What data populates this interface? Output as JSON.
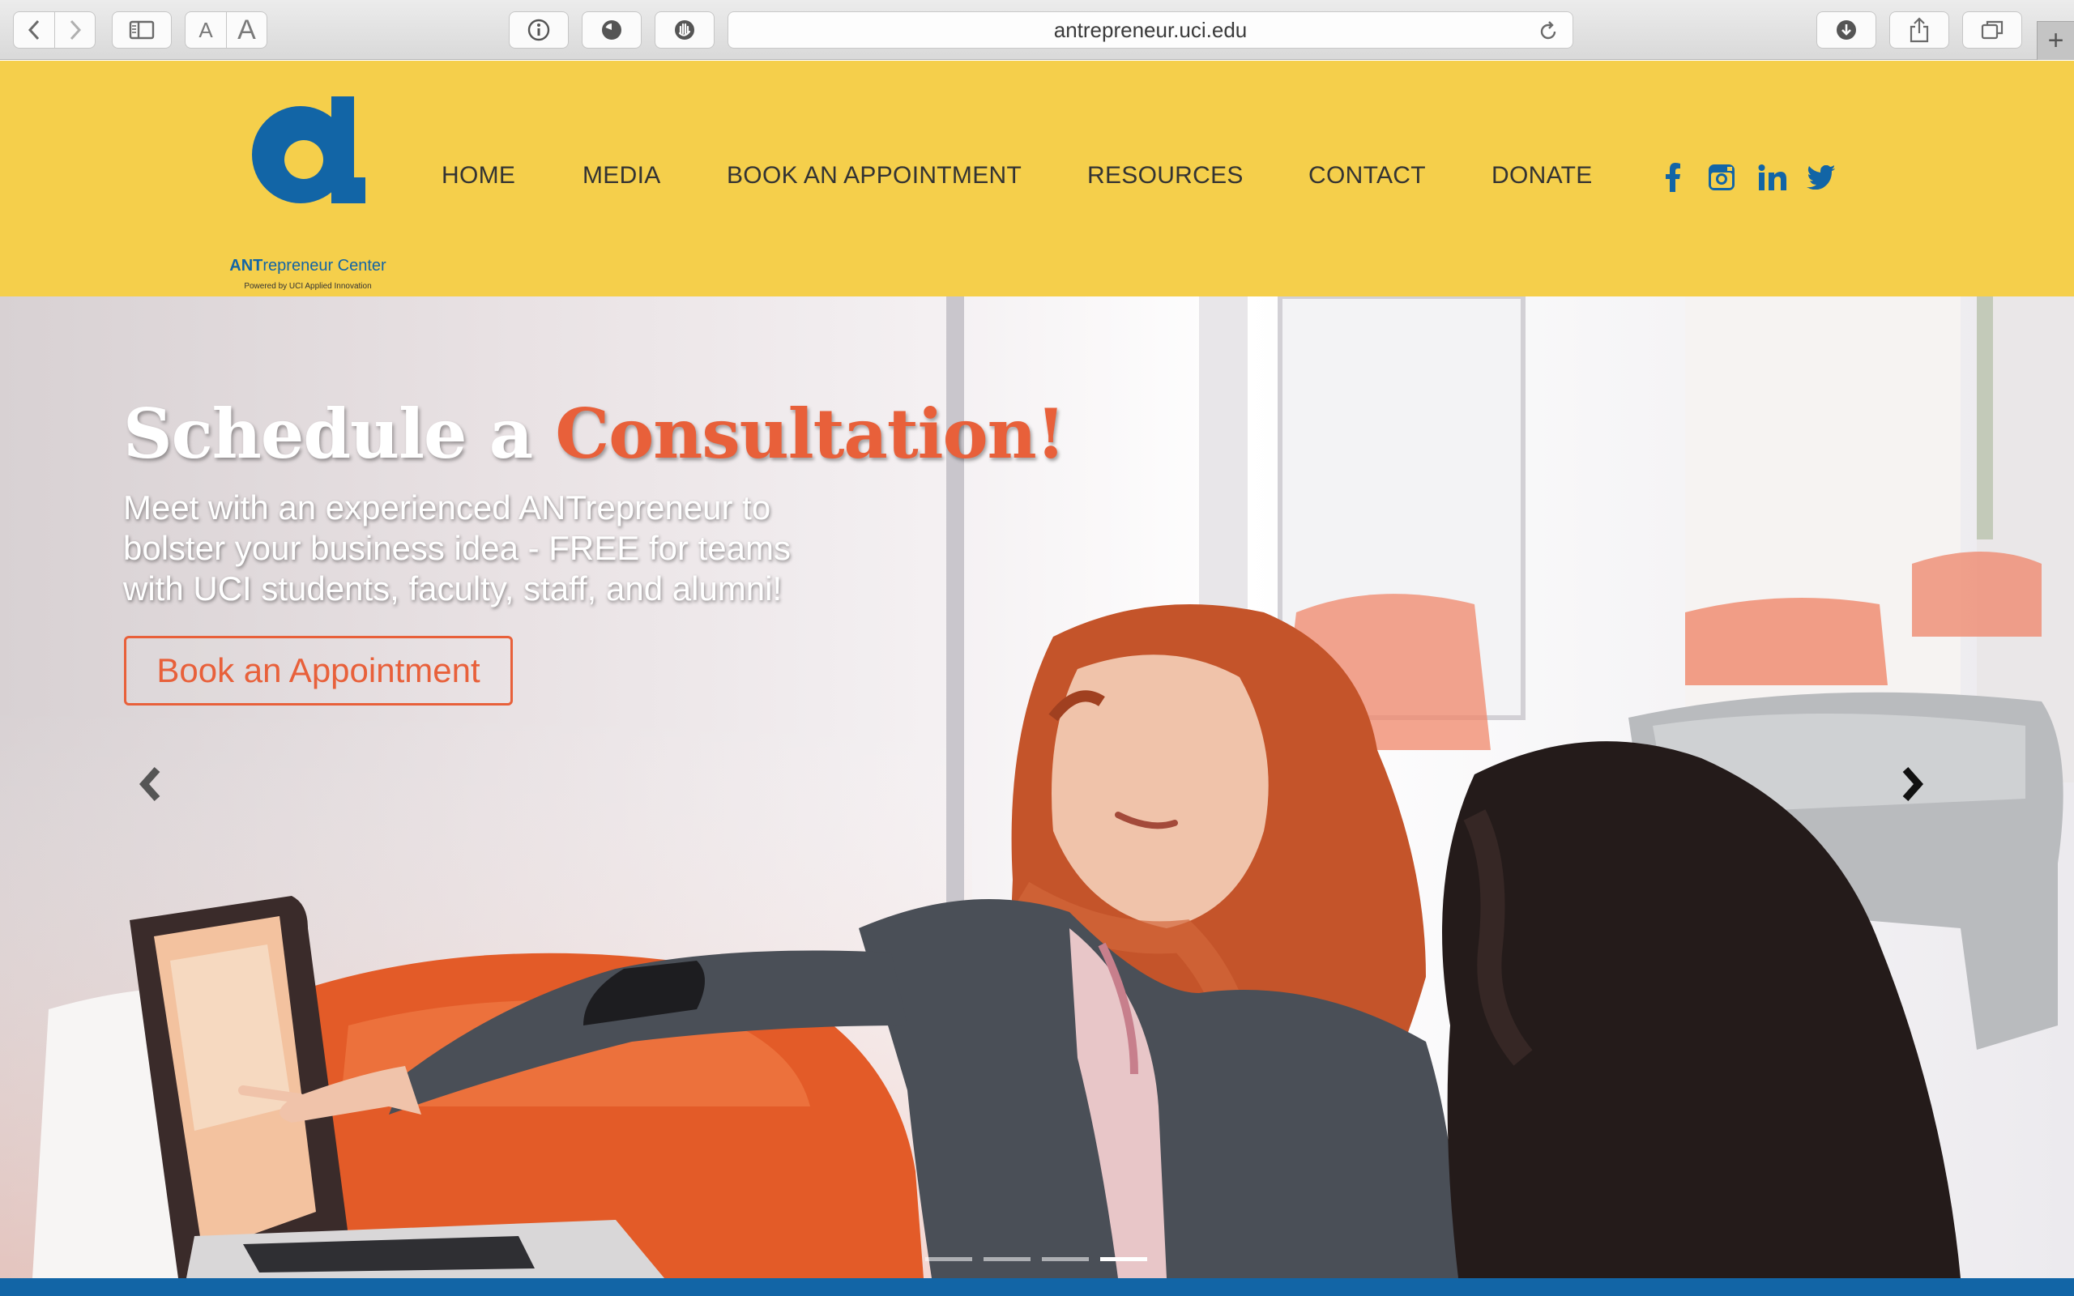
{
  "browser": {
    "url": "antrepreneur.uci.edu",
    "font_small_label": "A",
    "font_large_label": "A",
    "icons": [
      "back-icon",
      "forward-icon",
      "sidebar-icon",
      "info-icon",
      "history-icon",
      "stop-hand-icon",
      "reload-icon",
      "download-icon",
      "share-icon",
      "tabs-icon",
      "new-tab-icon"
    ],
    "new_tab_label": "+"
  },
  "site": {
    "colors": {
      "header_bg": "#f5cf4b",
      "brand_blue": "#1265a6",
      "accent_orange": "#e8603a"
    },
    "logo": {
      "name_bold": "ANT",
      "name_rest": "repreneur Center",
      "tagline": "Powered by UCI Applied Innovation"
    },
    "nav": [
      {
        "label": "HOME"
      },
      {
        "label": "MEDIA"
      },
      {
        "label": "BOOK AN APPOINTMENT"
      },
      {
        "label": "RESOURCES"
      },
      {
        "label": "CONTACT"
      },
      {
        "label": "DONATE"
      }
    ],
    "social": [
      "facebook-icon",
      "instagram-icon",
      "linkedin-icon",
      "twitter-icon"
    ]
  },
  "hero": {
    "title_start": "Schedule a ",
    "title_accent": "Consultation!",
    "subtitle": "Meet with an experienced ANTrepreneur to bolster your business idea - FREE for teams with UCI students, faculty, staff, and alumni!",
    "cta_label": "Book an Appointment",
    "slides_count": 4,
    "active_slide": 4
  }
}
